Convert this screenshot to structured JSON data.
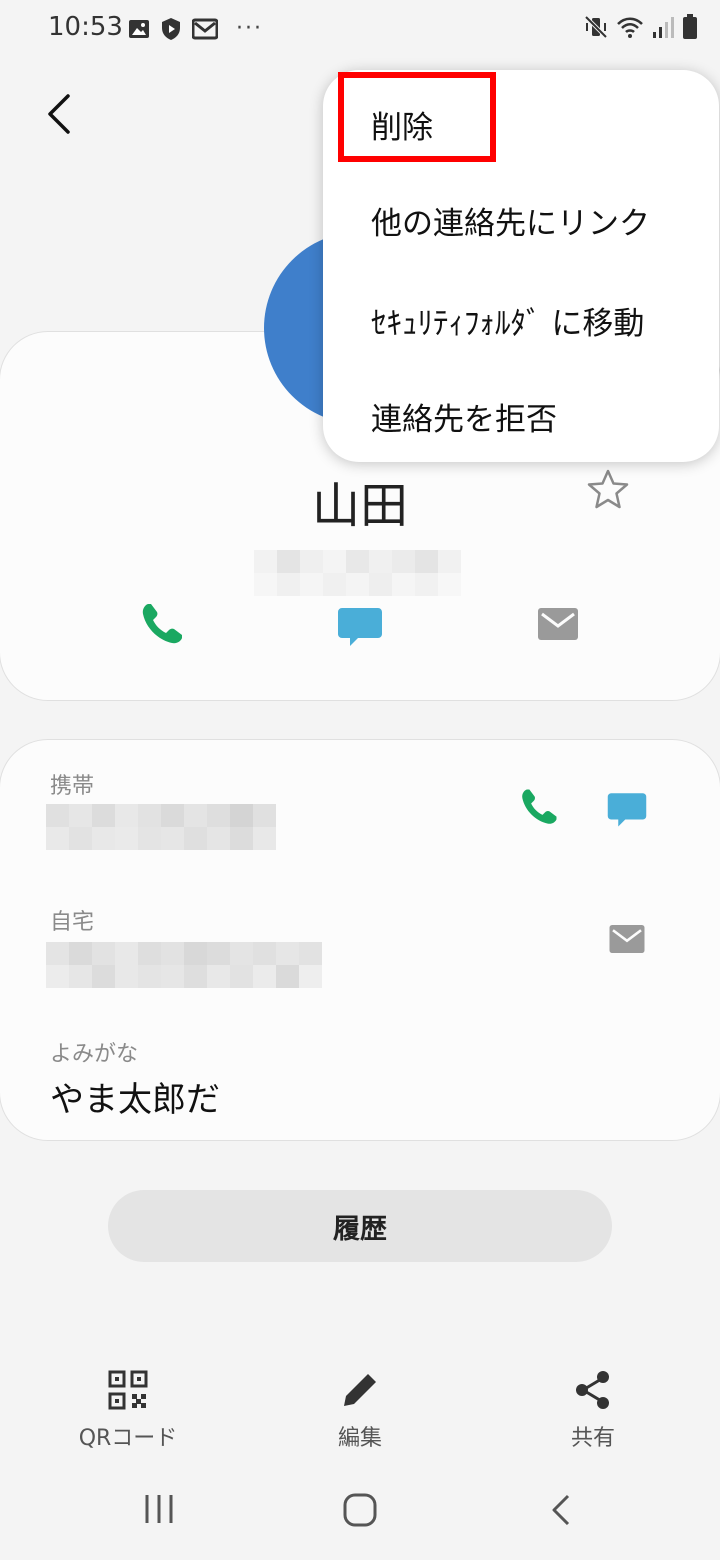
{
  "status_bar": {
    "time": "10:53",
    "left_icons": [
      "image-icon",
      "shield-play-icon",
      "mail-icon",
      "more-icon"
    ],
    "more_glyph": "···",
    "right_icons": [
      "mute-vibrate-icon",
      "wifi-icon",
      "signal-icon",
      "battery-icon"
    ]
  },
  "contact": {
    "name": "山田",
    "avatar_color": "#3f7fcb",
    "favorite_icon": "star-outline-icon"
  },
  "quick_actions": [
    {
      "name": "call",
      "icon": "phone-icon",
      "color": "#1aa861"
    },
    {
      "name": "message",
      "icon": "message-icon",
      "color": "#4aaed8"
    },
    {
      "name": "email",
      "icon": "mail-icon",
      "color": "#9a9a9a"
    }
  ],
  "details": {
    "mobile_label": "携帯",
    "home_label": "自宅",
    "furigana_label": "よみがな",
    "furigana_value": "やま太郎だ"
  },
  "history_button": "履歴",
  "bottom_bar": [
    {
      "label": "QRコード",
      "icon": "qr-code-icon"
    },
    {
      "label": "編集",
      "icon": "pencil-icon"
    },
    {
      "label": "共有",
      "icon": "share-icon"
    }
  ],
  "navigation_bar": [
    "recents-icon",
    "home-icon",
    "back-icon"
  ],
  "overflow_menu": {
    "items": [
      "削除",
      "他の連絡先にリンク",
      "ｾｷｭﾘﾃｨﾌｫﾙﾀﾞ に移動",
      "連絡先を拒否"
    ],
    "highlighted_item": "削除",
    "highlight_color": "#ff0000"
  }
}
